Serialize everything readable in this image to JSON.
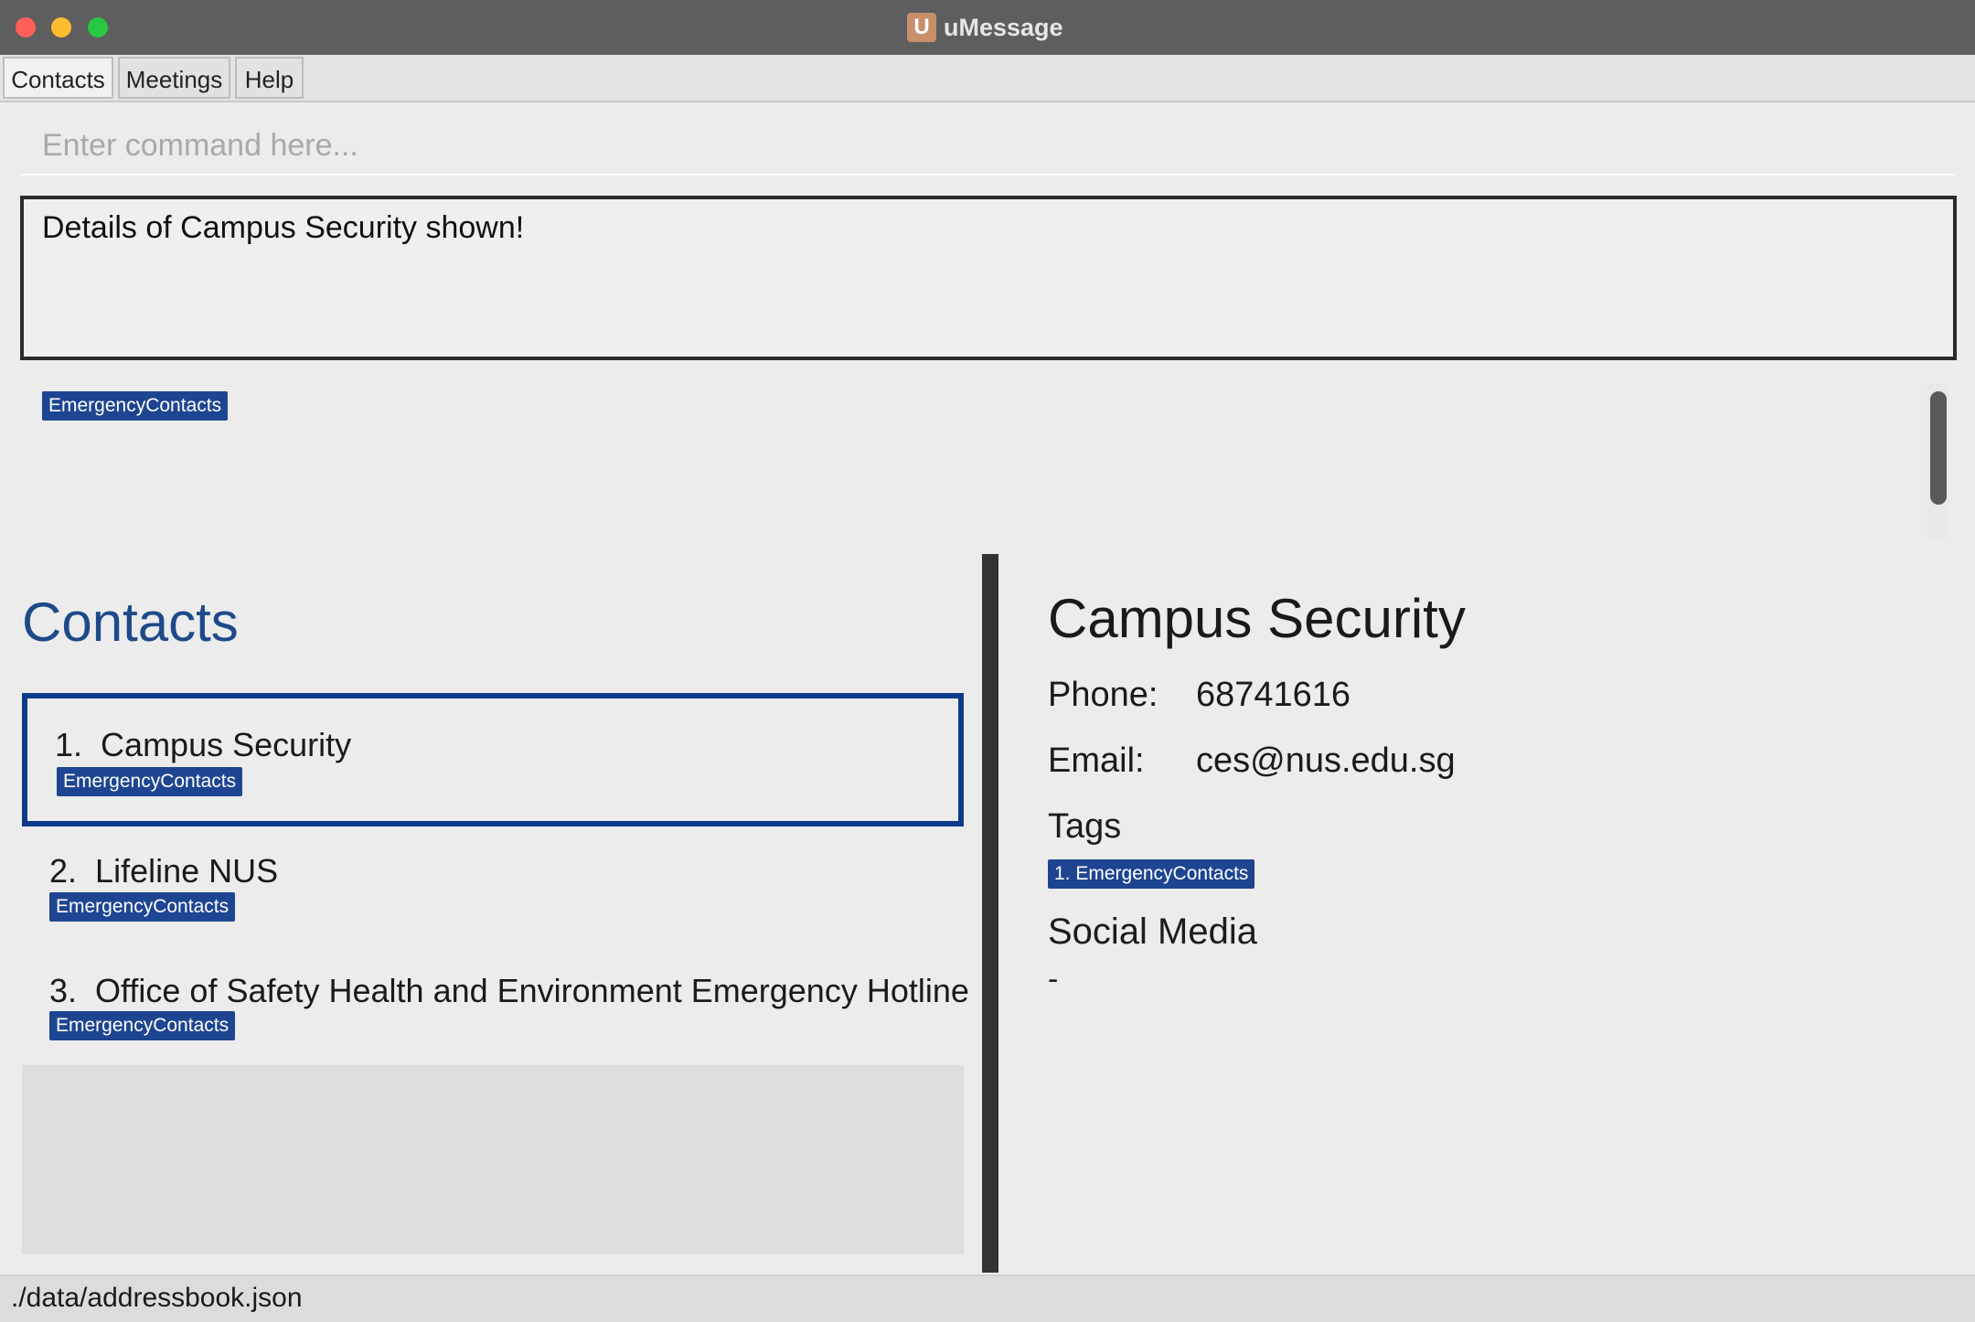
{
  "window": {
    "title": "uMessage",
    "logo_letter": "U"
  },
  "menu": {
    "items": [
      "Contacts",
      "Meetings",
      "Help"
    ]
  },
  "command": {
    "placeholder": "Enter command here...",
    "value": ""
  },
  "result": {
    "message": "Details of Campus Security shown!"
  },
  "tag_strip": {
    "tags": [
      "EmergencyContacts"
    ]
  },
  "contacts": {
    "heading": "Contacts",
    "items": [
      {
        "index": "1.",
        "name": "Campus Security",
        "tag": "EmergencyContacts",
        "selected": true
      },
      {
        "index": "2.",
        "name": "Lifeline NUS",
        "tag": "EmergencyContacts",
        "selected": false
      },
      {
        "index": "3.",
        "name": "Office of Safety Health and Environment Emergency Hotline",
        "tag": "EmergencyContacts",
        "selected": false
      }
    ]
  },
  "details": {
    "name": "Campus Security",
    "phone_label": "Phone:",
    "phone": "68741616",
    "email_label": "Email:",
    "email": "ces@nus.edu.sg",
    "tags_heading": "Tags",
    "tags": [
      "1. EmergencyContacts"
    ],
    "social_heading": "Social Media",
    "social_value": "-"
  },
  "status": {
    "path": "./data/addressbook.json"
  },
  "colors": {
    "accent": "#1e4a8a",
    "tag_bg": "#1d4591",
    "selected_border": "#0d3b8a"
  }
}
